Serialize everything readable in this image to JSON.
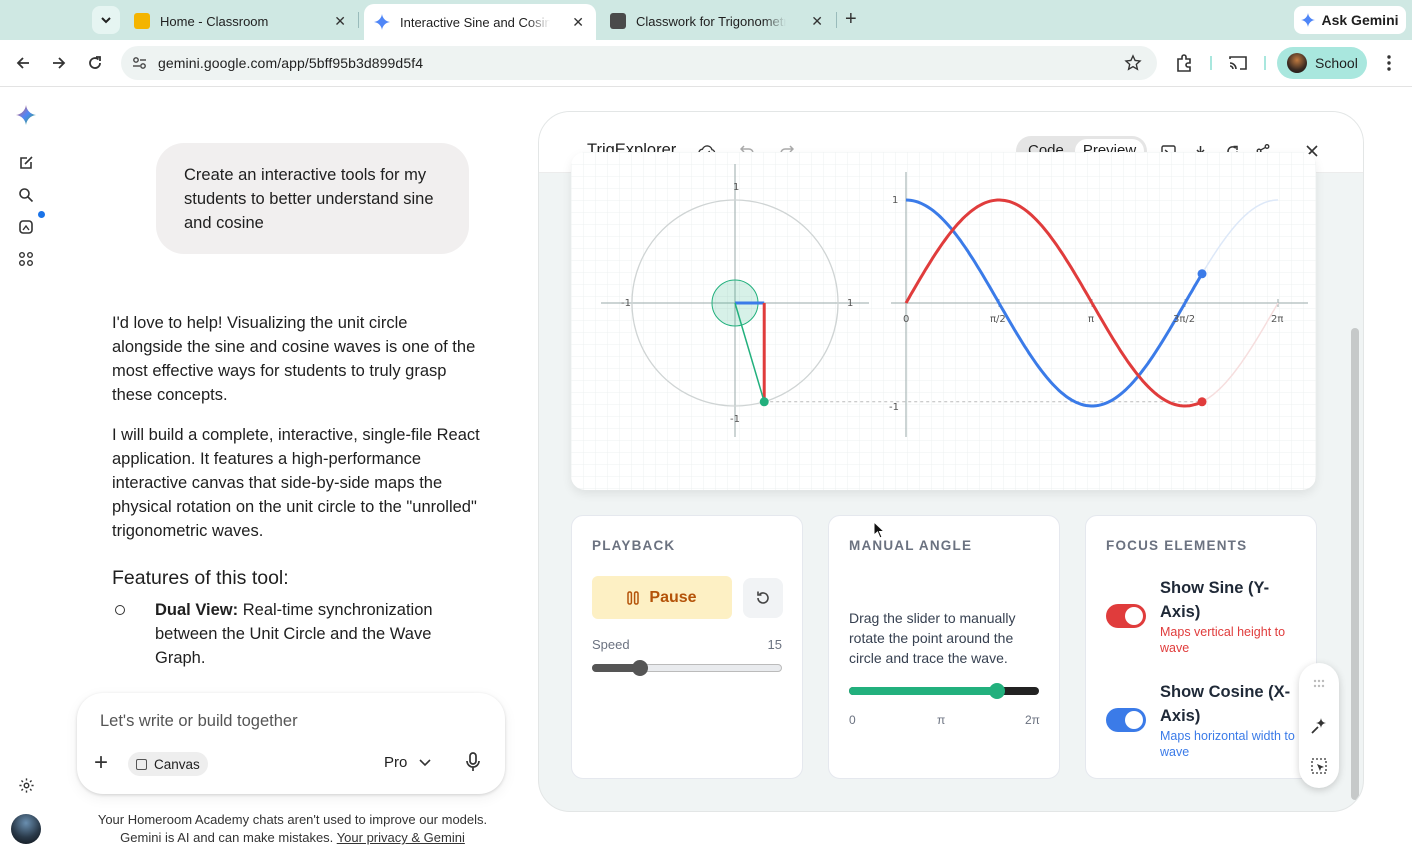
{
  "browser": {
    "tabs": [
      {
        "title": "Home - Classroom",
        "active": false
      },
      {
        "title": "Interactive Sine and Cosine Visualizer",
        "active": true
      },
      {
        "title": "Classwork for Trigonometry Section",
        "active": false
      }
    ],
    "ask_gemini": "Ask Gemini",
    "url": "gemini.google.com/app/5bff95b3d899d5f4",
    "profile": "School"
  },
  "chat": {
    "user_message": "Create an interactive tools for my students to better understand sine and cosine",
    "response_p1": "I'd love to help! Visualizing the unit circle alongside the sine and cosine waves is one of the most effective ways for students to truly grasp these concepts.",
    "response_p2": "I will build a complete, interactive, single-file React application. It features a high-performance interactive canvas that side-by-side maps the physical rotation on the unit circle to the \"unrolled\" trigonometric waves.",
    "features_heading": "Features of this tool:",
    "feature1_title": "Dual View:",
    "feature1_text": " Real-time synchronization between the Unit Circle and the Wave Graph.",
    "input_placeholder": "Let's write or build together",
    "canvas_chip": "Canvas",
    "model": "Pro",
    "disclaimer_line1": "Your Homeroom Academy chats aren't used to improve our models.",
    "disclaimer_line2": "Gemini is AI and can make mistakes.",
    "privacy_link": "Your privacy & Gemini"
  },
  "canvas": {
    "title": "TrigExplorer",
    "code_label": "Code",
    "preview_label": "Preview",
    "graph": {
      "circle_labels": {
        "left": "-1",
        "right": "1",
        "top": "1",
        "bottom": "-1"
      },
      "wave_y_labels": {
        "top": "1",
        "bottom": "-1"
      },
      "wave_x_labels": [
        "0",
        "π/2",
        "π",
        "3π/2",
        "2π"
      ],
      "current_angle_rad": 5.0,
      "colors": {
        "sine": "#e03c3c",
        "cosine": "#3b7be8",
        "radius": "#22b07d",
        "circle": "#cfd4d4"
      }
    },
    "playback": {
      "heading": "PLAYBACK",
      "pause_label": "Pause",
      "speed_label": "Speed",
      "speed_value": "15",
      "speed_fraction": 0.25
    },
    "manual_angle": {
      "heading": "MANUAL ANGLE",
      "description": "Drag the slider to manually rotate the point around the circle and trace the wave.",
      "ticks": [
        "0",
        "π",
        "2π"
      ],
      "slider_fraction": 0.78
    },
    "focus": {
      "heading": "FOCUS ELEMENTS",
      "sine_title": "Show Sine (Y-Axis)",
      "sine_desc": "Maps vertical height to wave",
      "cosine_title": "Show Cosine (X-Axis)",
      "cosine_desc": "Maps horizontal width to wave",
      "sine_color": "#e03c3c",
      "cosine_color": "#3b7be8"
    }
  }
}
